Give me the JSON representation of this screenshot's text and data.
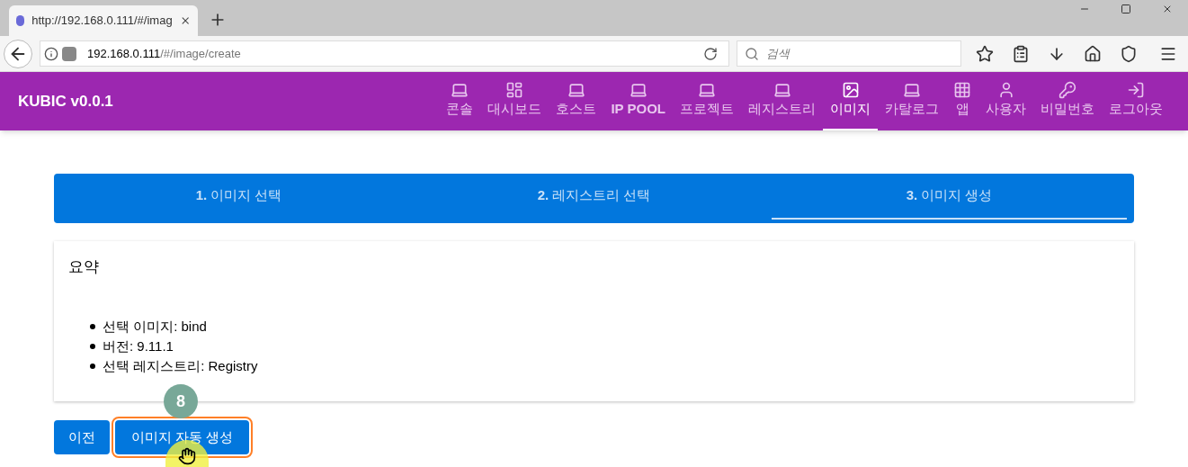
{
  "browser": {
    "tab_title": "http://192.168.0.111/#/imag",
    "url_host": "192.168.0.111",
    "url_path": "/#/image/create",
    "search_placeholder": "검색"
  },
  "app": {
    "title": "KUBIC v0.0.1",
    "nav": [
      {
        "label": "콘솔",
        "kind": "laptop",
        "bold": false,
        "selected": false
      },
      {
        "label": "대시보드",
        "kind": "dashboard",
        "bold": false,
        "selected": false
      },
      {
        "label": "호스트",
        "kind": "laptop",
        "bold": false,
        "selected": false
      },
      {
        "label": "IP POOL",
        "kind": "laptop",
        "bold": true,
        "selected": false
      },
      {
        "label": "프로젝트",
        "kind": "laptop",
        "bold": false,
        "selected": false
      },
      {
        "label": "레지스트리",
        "kind": "laptop",
        "bold": false,
        "selected": false
      },
      {
        "label": "이미지",
        "kind": "image",
        "bold": false,
        "selected": true
      },
      {
        "label": "카탈로그",
        "kind": "laptop",
        "bold": false,
        "selected": false
      },
      {
        "label": "앱",
        "kind": "apps",
        "bold": false,
        "selected": false
      },
      {
        "label": "사용자",
        "kind": "person",
        "bold": false,
        "selected": false
      },
      {
        "label": "비밀번호",
        "kind": "key",
        "bold": false,
        "selected": false
      },
      {
        "label": "로그아웃",
        "kind": "logout",
        "bold": false,
        "selected": false
      }
    ]
  },
  "stepper": [
    {
      "number": "1.",
      "label": "이미지 선택",
      "selected": false
    },
    {
      "number": "2.",
      "label": "레지스트리 선택",
      "selected": false
    },
    {
      "number": "3.",
      "label": "이미지 생성",
      "selected": true
    }
  ],
  "summary": {
    "title": "요약",
    "items": [
      {
        "label": "선택 이미지:",
        "value": "bind"
      },
      {
        "label": "버전:",
        "value": "9.11.1"
      },
      {
        "label": "선택 레지스트리:",
        "value": "Registry"
      }
    ]
  },
  "buttons": [
    {
      "label": "이전",
      "highlighted": false
    },
    {
      "label": "이미지 자동 생성",
      "highlighted": true
    }
  ],
  "step_badge": "8"
}
